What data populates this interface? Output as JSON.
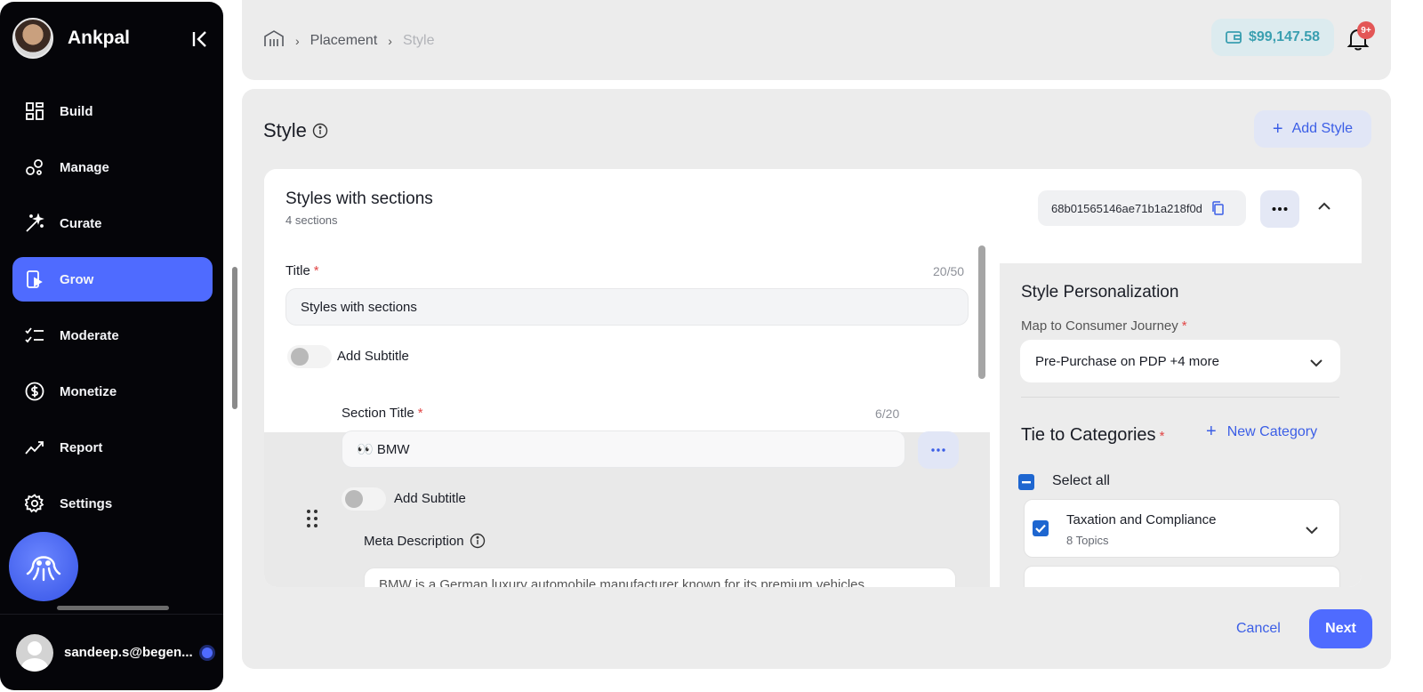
{
  "sidebar": {
    "brand_name": "Ankpal",
    "items": [
      {
        "label": "Build",
        "icon": "grid-icon"
      },
      {
        "label": "Manage",
        "icon": "manage-icon"
      },
      {
        "label": "Curate",
        "icon": "magic-wand-icon"
      },
      {
        "label": "Grow",
        "icon": "grow-icon",
        "active": true
      },
      {
        "label": "Moderate",
        "icon": "checklist-icon"
      },
      {
        "label": "Monetize",
        "icon": "dollar-icon"
      },
      {
        "label": "Report",
        "icon": "trend-icon"
      },
      {
        "label": "Settings",
        "icon": "gear-icon"
      }
    ],
    "user_email": "sandeep.s@begen..."
  },
  "header": {
    "breadcrumb": [
      "Placement",
      "Style"
    ],
    "wallet_balance": "$99,147.58",
    "notification_badge": "9+"
  },
  "page": {
    "title": "Style",
    "add_style_label": "Add Style"
  },
  "style_card": {
    "title": "Styles with sections",
    "subtitle": "4 sections",
    "id": "68b01565146ae71b1a218f0d"
  },
  "form": {
    "title_label": "Title",
    "title_counter": "20/50",
    "title_value": "Styles with sections",
    "add_subtitle_label": "Add Subtitle",
    "section_title_label": "Section Title",
    "section_counter": "6/20",
    "section_value": "👀 BMW",
    "section_add_subtitle_label": "Add Subtitle",
    "meta_description_label": "Meta Description",
    "meta_description_value": "BMW is a German luxury automobile manufacturer known for its premium vehicles"
  },
  "personalization": {
    "title": "Style Personalization",
    "journey_label": "Map to Consumer Journey",
    "journey_value": "Pre-Purchase on PDP +4 more",
    "categories_label": "Tie to Categories",
    "new_category_label": "New Category",
    "select_all_label": "Select all",
    "category": {
      "title": "Taxation and Compliance",
      "subtitle": "8 Topics"
    }
  },
  "footer": {
    "cancel_label": "Cancel",
    "next_label": "Next"
  },
  "colors": {
    "accent": "#4f6bff",
    "link": "#3b5ee6",
    "wallet": "#3a9fb0",
    "sidebar_bg": "#050509"
  }
}
